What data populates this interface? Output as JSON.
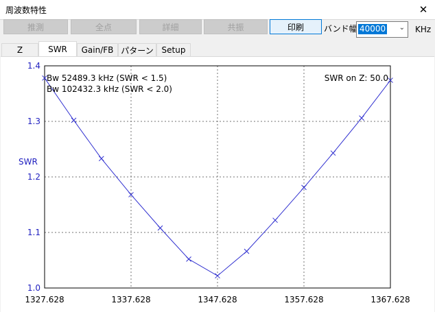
{
  "window": {
    "title": "周波数特性"
  },
  "toolbar": {
    "buttons": [
      {
        "label": "推測",
        "enabled": false
      },
      {
        "label": "全点",
        "enabled": false
      },
      {
        "label": "詳細",
        "enabled": false
      },
      {
        "label": "共振",
        "enabled": false
      },
      {
        "label": "印刷",
        "enabled": true
      }
    ],
    "band_label": "バンド幅",
    "band_value": "40000",
    "band_unit": "KHz"
  },
  "tabs": [
    "Z",
    "SWR",
    "Gain/FB",
    "パターン",
    "Setup"
  ],
  "active_tab": "SWR",
  "chart_data": {
    "type": "line",
    "ylabel": "SWR",
    "x_ticks": [
      "1327.628",
      "1337.628",
      "1347.628",
      "1357.628",
      "1367.628"
    ],
    "y_ticks": [
      "1.0",
      "1.1",
      "1.2",
      "1.3",
      "1.4"
    ],
    "xlim": [
      1327.628,
      1367.628
    ],
    "ylim": [
      1.0,
      1.4
    ],
    "grid": true,
    "line_color": "#3030d0",
    "annotations": {
      "bw1": "Bw 52489.3 kHz (SWR < 1.5)",
      "bw2": "Bw 102432.3 kHz (SWR < 2.0)",
      "z": "SWR on Z: 50.0"
    },
    "series": [
      {
        "x": [
          1327.628,
          1331.0,
          1334.2,
          1337.628,
          1341.0,
          1344.3,
          1347.628,
          1351.0,
          1354.3,
          1357.628,
          1361.0,
          1364.3,
          1367.628
        ],
        "y": [
          1.378,
          1.302,
          1.233,
          1.168,
          1.108,
          1.052,
          1.022,
          1.066,
          1.122,
          1.181,
          1.243,
          1.306,
          1.374
        ]
      }
    ]
  }
}
